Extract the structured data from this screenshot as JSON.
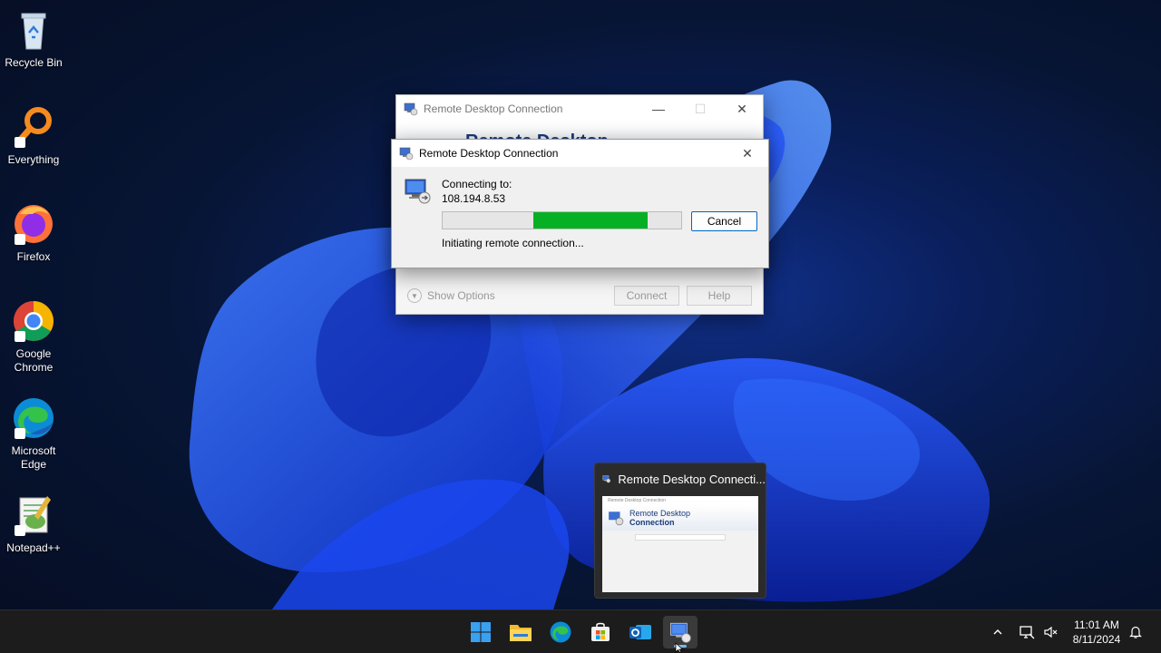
{
  "desktop": {
    "icons": [
      {
        "label": "Recycle Bin",
        "icon": "recycle-bin-icon"
      },
      {
        "label": "Everything",
        "icon": "everything-icon"
      },
      {
        "label": "Firefox",
        "icon": "firefox-icon"
      },
      {
        "label": "Google Chrome",
        "icon": "chrome-icon"
      },
      {
        "label": "Microsoft Edge",
        "icon": "edge-icon"
      },
      {
        "label": "Notepad++",
        "icon": "notepadpp-icon"
      }
    ]
  },
  "background_window": {
    "title": "Remote Desktop Connection",
    "banner_title": "Remote Desktop",
    "show_options": "Show Options",
    "connect_label": "Connect",
    "help_label": "Help"
  },
  "dialog": {
    "title": "Remote Desktop Connection",
    "connecting_label": "Connecting to:",
    "address": "108.194.8.53",
    "status": "Initiating remote connection...",
    "cancel_label": "Cancel",
    "progress": {
      "start": 0.38,
      "end": 0.86,
      "color": "#06b025"
    }
  },
  "preview": {
    "title": "Remote Desktop Connecti...",
    "thumb_titlebar": "Remote Desktop Connection",
    "thumb_line1": "Remote Desktop",
    "thumb_line2": "Connection"
  },
  "taskbar": {
    "apps": [
      "start-icon",
      "file-explorer-icon",
      "edge-icon",
      "store-icon",
      "outlook-icon",
      "remote-desktop-icon"
    ],
    "active_app": "remote-desktop-icon",
    "accent": "#76b9ed",
    "time": "11:01 AM",
    "date": "8/11/2024"
  }
}
